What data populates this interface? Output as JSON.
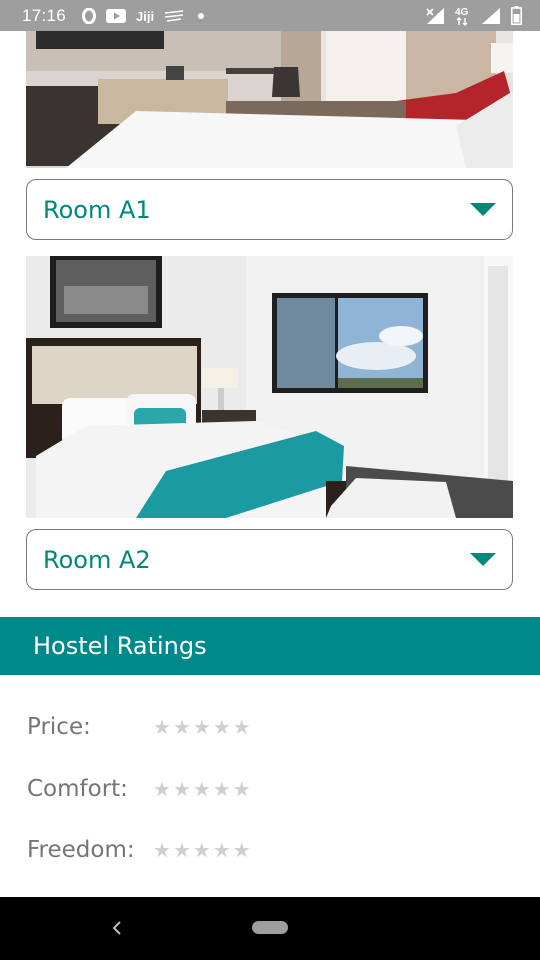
{
  "status_bar": {
    "time": "17:16",
    "left_icons": [
      "opera-icon",
      "youtube-icon",
      "jiji-icon",
      "glasses-icon",
      "dot-icon"
    ],
    "jiji_label": "Jiji",
    "network_label": "4G",
    "right_icons": [
      "signal-x-icon",
      "network-4g-icon",
      "signal-icon",
      "battery-icon"
    ]
  },
  "rooms": [
    {
      "photo_name": "room-a1-photo",
      "selected": "Room A1"
    },
    {
      "photo_name": "room-a2-photo",
      "selected": "Room A2"
    }
  ],
  "ratings": {
    "title": "Hostel Ratings",
    "items": [
      {
        "label": "Price:",
        "stars": 0,
        "max": 5
      },
      {
        "label": "Comfort:",
        "stars": 0,
        "max": 5
      },
      {
        "label": "Freedom:",
        "stars": 0,
        "max": 5
      }
    ]
  },
  "colors": {
    "accent": "#00898a",
    "dropdown_text": "#00897b",
    "star_empty": "#cfcfcf",
    "label_text": "#757575",
    "status_bar": "#9e9e9e"
  },
  "nav_bar": {
    "icons": [
      "back-icon",
      "home-pill-icon"
    ]
  }
}
